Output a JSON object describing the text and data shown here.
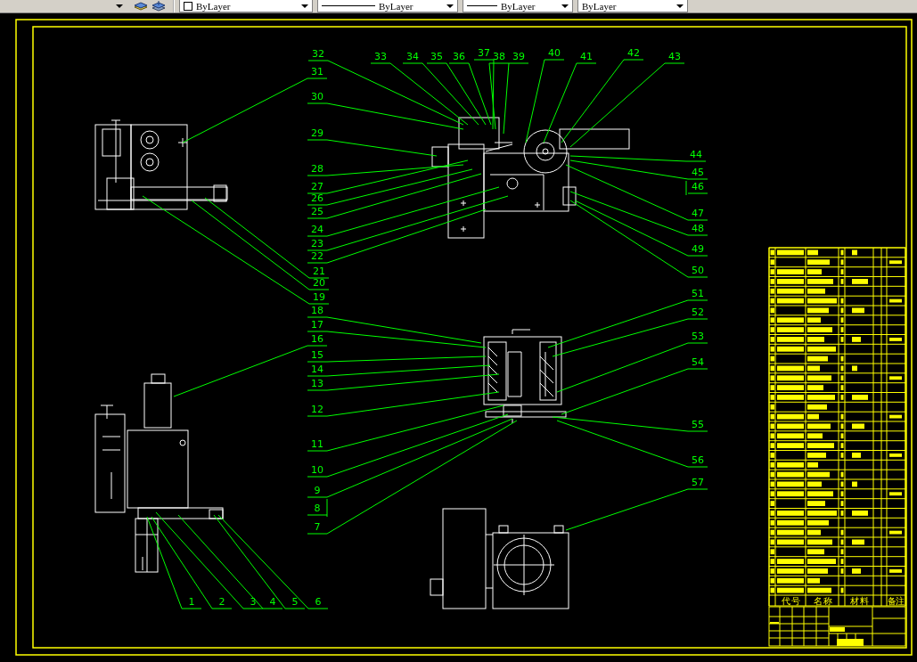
{
  "toolbar": {
    "combos": [
      {
        "kind": "color",
        "value": "ByLayer"
      },
      {
        "kind": "linetype",
        "value": "ByLayer"
      },
      {
        "kind": "lineweight",
        "value": "ByLayer"
      },
      {
        "kind": "plotstyle",
        "value": "ByLayer"
      }
    ]
  },
  "drawing": {
    "top_row_numbers": [
      "32",
      "33",
      "34",
      "35",
      "36",
      "37",
      "38",
      "39",
      "40",
      "41",
      "42",
      "43"
    ],
    "left_column_numbers": [
      "31",
      "30",
      "29",
      "28",
      "27",
      "26",
      "25",
      "24",
      "23",
      "22",
      "21",
      "20",
      "19",
      "18",
      "17",
      "16",
      "15",
      "14",
      "13",
      "12",
      "11",
      "10",
      "9",
      "8",
      "7"
    ],
    "right_column_numbers": [
      "44",
      "45",
      "46",
      "47",
      "48",
      "49",
      "50",
      "51",
      "52",
      "53",
      "54",
      "55",
      "56",
      "57"
    ],
    "bottom_row_numbers": [
      "1",
      "2",
      "3",
      "4",
      "5",
      "6"
    ],
    "parts_list": {
      "header": [
        "代 号",
        "名 称",
        "材 料",
        "备注"
      ]
    }
  }
}
